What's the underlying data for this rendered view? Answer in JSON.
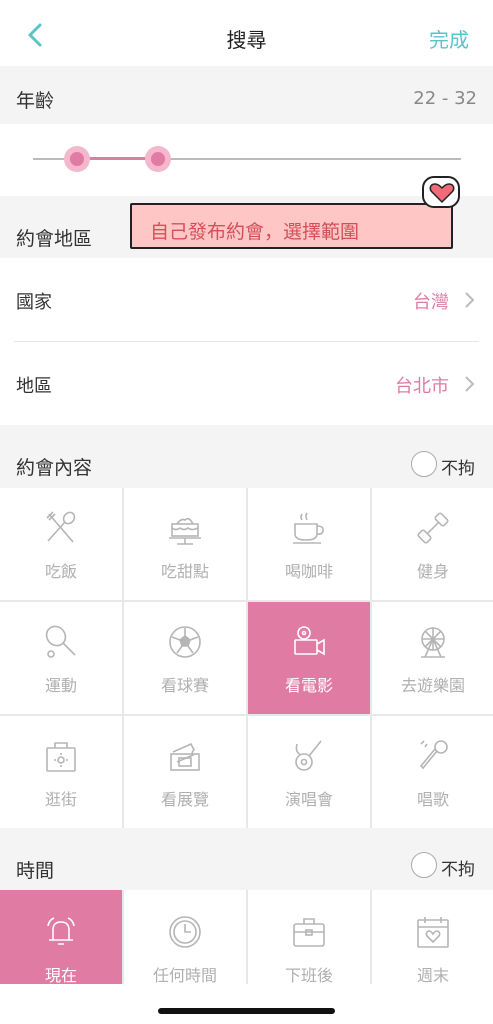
{
  "nav": {
    "title": "搜尋",
    "done_label": "完成"
  },
  "age": {
    "label": "年齡",
    "range_text": "22 - 32",
    "range_min_fraction": 0.1,
    "range_max_fraction": 0.29
  },
  "tooltip": {
    "text": "自己發布約會，選擇範圍"
  },
  "region": {
    "label": "約會地區",
    "country_label": "國家",
    "country_value": "台灣",
    "area_label": "地區",
    "area_value": "台北市"
  },
  "content": {
    "label": "約會內容",
    "nolimit_label": "不拘",
    "items": [
      {
        "label": "吃飯",
        "icon": "fork-spoon-icon",
        "selected": false
      },
      {
        "label": "吃甜點",
        "icon": "cake-icon",
        "selected": false
      },
      {
        "label": "喝咖啡",
        "icon": "coffee-cup-icon",
        "selected": false
      },
      {
        "label": "健身",
        "icon": "dumbbell-icon",
        "selected": false
      },
      {
        "label": "運動",
        "icon": "tennis-racket-icon",
        "selected": false
      },
      {
        "label": "看球賽",
        "icon": "soccer-ball-icon",
        "selected": false
      },
      {
        "label": "看電影",
        "icon": "film-camera-icon",
        "selected": true
      },
      {
        "label": "去遊樂園",
        "icon": "ferris-wheel-icon",
        "selected": false
      },
      {
        "label": "逛街",
        "icon": "shopping-bag-icon",
        "selected": false
      },
      {
        "label": "看展覽",
        "icon": "ticket-icon",
        "selected": false
      },
      {
        "label": "演唱會",
        "icon": "guitar-icon",
        "selected": false
      },
      {
        "label": "唱歌",
        "icon": "microphone-icon",
        "selected": false
      }
    ]
  },
  "time": {
    "label": "時間",
    "nolimit_label": "不拘",
    "items": [
      {
        "label": "現在",
        "icon": "alarm-bell-icon",
        "selected": true
      },
      {
        "label": "任何時間",
        "icon": "clock-icon",
        "selected": false
      },
      {
        "label": "下班後",
        "icon": "briefcase-icon",
        "selected": false
      },
      {
        "label": "週末",
        "icon": "calendar-icon",
        "selected": false
      }
    ]
  },
  "colors": {
    "accent_pink": "#e07ba3",
    "accent_teal": "#5ac3c8",
    "tooltip_bg": "#ffc6c6"
  }
}
